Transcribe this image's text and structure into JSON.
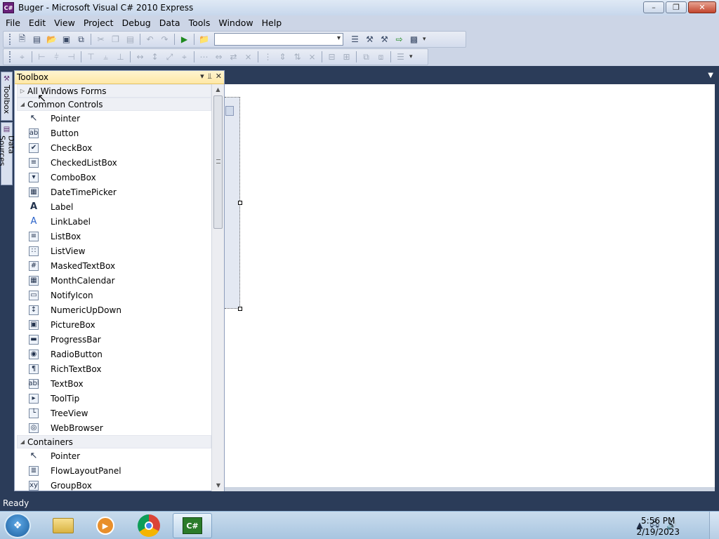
{
  "window": {
    "title": "Buger - Microsoft Visual C# 2010 Express",
    "icon_label": "C#",
    "minimize_glyph": "–",
    "maximize_glyph": "❐",
    "close_glyph": "✕"
  },
  "menu": [
    "File",
    "Edit",
    "View",
    "Project",
    "Debug",
    "Data",
    "Tools",
    "Window",
    "Help"
  ],
  "toolbar": {
    "combo_value": ""
  },
  "siderail": {
    "toolbox_tab": "Toolbox",
    "datasources_tab": "Data Sources"
  },
  "toolbox": {
    "title": "Toolbox",
    "header_buttons": [
      "▾",
      "⫫",
      "✕"
    ],
    "categories": [
      {
        "label": "All Windows Forms",
        "expanded": false
      },
      {
        "label": "Common Controls",
        "expanded": true
      },
      {
        "label": "Containers",
        "expanded": true
      }
    ],
    "common_controls": [
      {
        "label": "Pointer",
        "icon": "pointer-icon",
        "glyph": "↖"
      },
      {
        "label": "Button",
        "icon": "button-icon",
        "glyph": "ab"
      },
      {
        "label": "CheckBox",
        "icon": "checkbox-icon",
        "glyph": "✔"
      },
      {
        "label": "CheckedListBox",
        "icon": "checkedlistbox-icon",
        "glyph": "≡"
      },
      {
        "label": "ComboBox",
        "icon": "combobox-icon",
        "glyph": "▾"
      },
      {
        "label": "DateTimePicker",
        "icon": "datetimepicker-icon",
        "glyph": "▦"
      },
      {
        "label": "Label",
        "icon": "label-icon",
        "glyph": "A"
      },
      {
        "label": "LinkLabel",
        "icon": "linklabel-icon",
        "glyph": "A"
      },
      {
        "label": "ListBox",
        "icon": "listbox-icon",
        "glyph": "≡"
      },
      {
        "label": "ListView",
        "icon": "listview-icon",
        "glyph": "∷"
      },
      {
        "label": "MaskedTextBox",
        "icon": "maskedtextbox-icon",
        "glyph": "#"
      },
      {
        "label": "MonthCalendar",
        "icon": "monthcalendar-icon",
        "glyph": "▦"
      },
      {
        "label": "NotifyIcon",
        "icon": "notifyicon-icon",
        "glyph": "▭"
      },
      {
        "label": "NumericUpDown",
        "icon": "numericupdown-icon",
        "glyph": "↕"
      },
      {
        "label": "PictureBox",
        "icon": "picturebox-icon",
        "glyph": "▣"
      },
      {
        "label": "ProgressBar",
        "icon": "progressbar-icon",
        "glyph": "▬"
      },
      {
        "label": "RadioButton",
        "icon": "radiobutton-icon",
        "glyph": "◉"
      },
      {
        "label": "RichTextBox",
        "icon": "richtextbox-icon",
        "glyph": "¶"
      },
      {
        "label": "TextBox",
        "icon": "textbox-icon",
        "glyph": "abl"
      },
      {
        "label": "ToolTip",
        "icon": "tooltip-icon",
        "glyph": "▸"
      },
      {
        "label": "TreeView",
        "icon": "treeview-icon",
        "glyph": "└"
      },
      {
        "label": "WebBrowser",
        "icon": "webbrowser-icon",
        "glyph": "◎"
      }
    ],
    "containers": [
      {
        "label": "Pointer",
        "icon": "pointer-icon",
        "glyph": "↖"
      },
      {
        "label": "FlowLayoutPanel",
        "icon": "flowlayoutpanel-icon",
        "glyph": "≣"
      },
      {
        "label": "GroupBox",
        "icon": "groupbox-icon",
        "glyph": "xy"
      }
    ]
  },
  "status": {
    "text": "Ready"
  },
  "taskbar": {
    "time": "5:56 PM",
    "date": "2/19/2023",
    "start_glyph": "❖"
  }
}
